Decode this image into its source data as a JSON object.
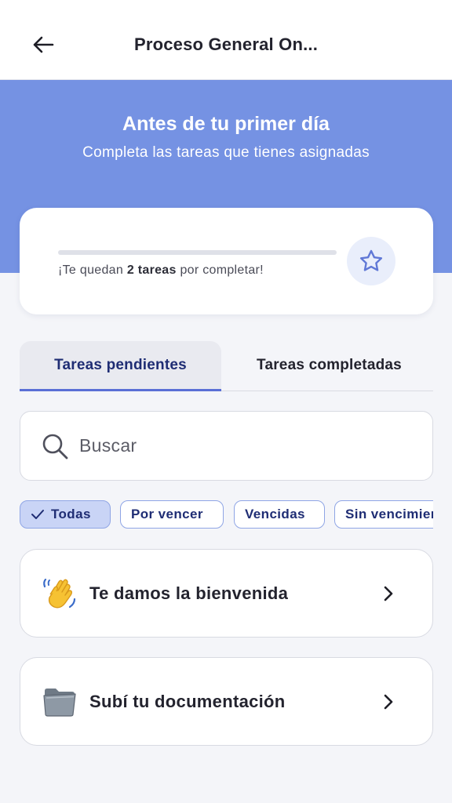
{
  "header": {
    "title": "Proceso General On..."
  },
  "hero": {
    "title": "Antes de tu primer día",
    "subtitle": "Completa las tareas que tienes asignadas"
  },
  "progress": {
    "fraction": 0,
    "text_before": "¡Te quedan ",
    "text_bold": "2 tareas",
    "text_after": " por completar!",
    "icon": "star-icon"
  },
  "tabs": [
    {
      "label": "Tareas pendientes",
      "active": true
    },
    {
      "label": "Tareas completadas",
      "active": false
    }
  ],
  "search": {
    "placeholder": "Buscar",
    "icon": "search-icon"
  },
  "filters": [
    {
      "label": "Todas",
      "selected": true
    },
    {
      "label": "Por vencer",
      "selected": false
    },
    {
      "label": "Vencidas",
      "selected": false
    },
    {
      "label": "Sin vencimiento",
      "selected": false
    }
  ],
  "tasks": [
    {
      "label": "Te damos la bienvenida",
      "icon": "waving-hand-icon"
    },
    {
      "label": "Subí tu documentación",
      "icon": "folder-icon"
    }
  ],
  "colors": {
    "accent": "#7592e3",
    "tab_active_text": "#1f2d74",
    "chip_selected_bg": "#c9d4f6"
  }
}
